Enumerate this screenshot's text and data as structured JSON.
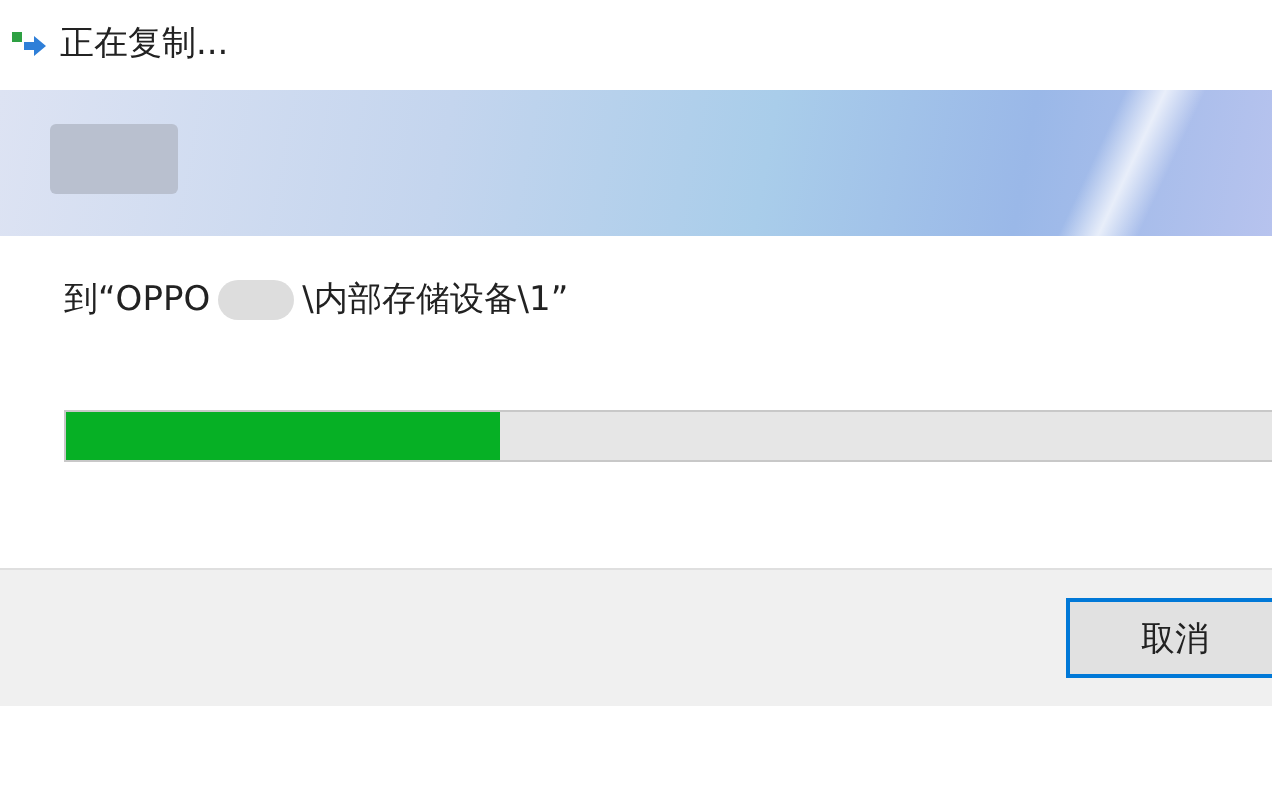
{
  "window": {
    "title": "正在复制..."
  },
  "destination": {
    "prefix": "到“OPPO",
    "suffix": "\\内部存储设备\\1”"
  },
  "progress": {
    "level": 0.36
  },
  "buttons": [
    {
      "label": "取消",
      "kind": "default"
    }
  ]
}
